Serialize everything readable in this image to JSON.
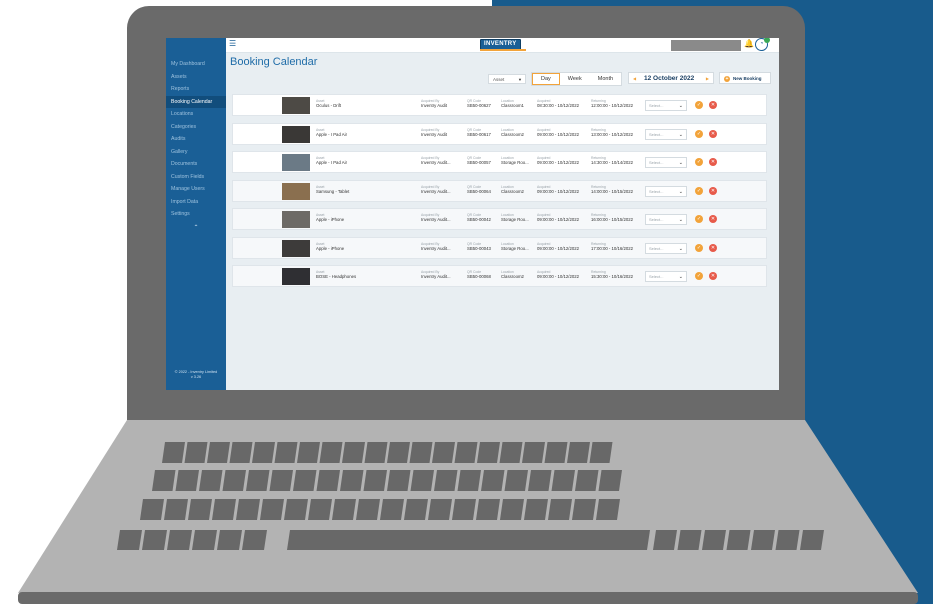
{
  "colors": {
    "brand_blue": "#1a5f96",
    "accent_orange": "#f2a33a",
    "reject_red": "#e75a4a",
    "laptop_grey": "#6a6a6a",
    "background_blue": "#185b8c"
  },
  "sidebar": {
    "items": [
      {
        "label": "My Dashboard"
      },
      {
        "label": "Assets"
      },
      {
        "label": "Reports"
      },
      {
        "label": "Booking Calendar",
        "active": true
      },
      {
        "label": "Locations"
      },
      {
        "label": "Categories"
      },
      {
        "label": "Audits"
      },
      {
        "label": "Gallery"
      },
      {
        "label": "Documents"
      },
      {
        "label": "Custom Fields"
      },
      {
        "label": "Manage Users"
      },
      {
        "label": "Import Data"
      },
      {
        "label": "Settings"
      }
    ],
    "collapse_icon": "chevron-up-icon",
    "footer_line1": "© 2022 - Inventry Limited",
    "footer_line2": "v 3.26"
  },
  "topbar": {
    "menu_icon": "hamburger-icon",
    "logo_text": "INVENTRY",
    "notification_icon": "bell-icon",
    "user_icon": "user-avatar-icon"
  },
  "header": {
    "title": "Booking Calendar",
    "filter_value": "Asset",
    "view_tabs": [
      {
        "label": "Day",
        "active": true
      },
      {
        "label": "Week"
      },
      {
        "label": "Month"
      }
    ],
    "date": "12 October 2022",
    "new_booking_label": "New Booking"
  },
  "labels": {
    "asset": "Asset",
    "acquired_by": "Acquired By",
    "qr_code": "QR Code",
    "location": "Location",
    "acquired": "Acquired",
    "returning": "Returning",
    "select_placeholder": "Select..."
  },
  "bookings": [
    {
      "asset": "Oculus - Drift",
      "acquired_by": "Inventry Audit",
      "qr_code": "SB50-00627",
      "location": "Classroom1",
      "acquired": "08:30:00 - 10/12/2022",
      "returning": "12:00:00 - 10/12/2022"
    },
    {
      "asset": "Apple - I Pad Air",
      "acquired_by": "Inventry Audit",
      "qr_code": "SB50-00617",
      "location": "Classroom2",
      "acquired": "09:00:00 - 10/12/2022",
      "returning": "13:00:00 - 10/12/2022"
    },
    {
      "asset": "Apple - I Pad Air",
      "acquired_by": "Inventry Audit...",
      "qr_code": "SB50-00057",
      "location": "Storage Roo...",
      "acquired": "09:00:00 - 10/12/2022",
      "returning": "14:30:00 - 10/14/2022"
    },
    {
      "asset": "Samsung - Tablet",
      "acquired_by": "Inventry Audit...",
      "qr_code": "SB50-00064",
      "location": "Classroom2",
      "acquired": "09:00:00 - 10/12/2022",
      "returning": "14:00:00 - 10/15/2022"
    },
    {
      "asset": "Apple - iPhone",
      "acquired_by": "Inventry Audit...",
      "qr_code": "SB50-00042",
      "location": "Storage Roo...",
      "acquired": "09:00:00 - 10/12/2022",
      "returning": "16:00:00 - 10/15/2022"
    },
    {
      "asset": "Apple - iPhone",
      "acquired_by": "Inventry Audit...",
      "qr_code": "SB50-00043",
      "location": "Storage Roo...",
      "acquired": "09:00:00 - 10/12/2022",
      "returning": "17:00:00 - 10/16/2022"
    },
    {
      "asset": "BOSE - Headphones",
      "acquired_by": "Inventry Audit...",
      "qr_code": "SB50-00068",
      "location": "Classroom2",
      "acquired": "09:00:00 - 10/12/2022",
      "returning": "15:30:00 - 10/16/2022"
    }
  ],
  "row_icons": {
    "approve": "check-circle-icon",
    "reject": "close-circle-icon",
    "dropdown": "chevron-down-icon"
  }
}
